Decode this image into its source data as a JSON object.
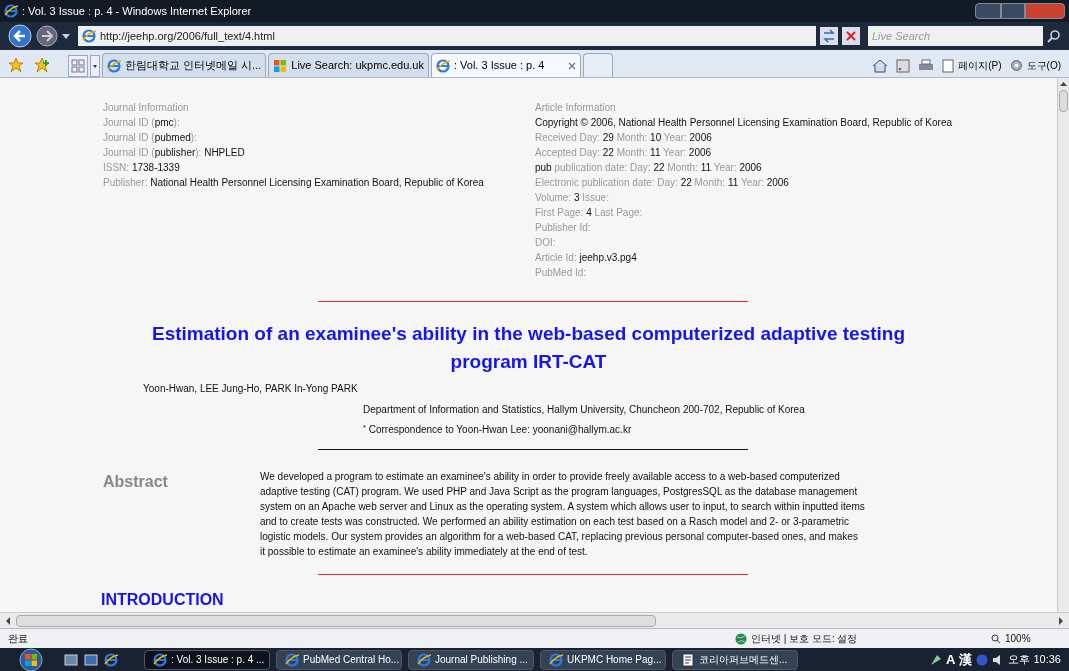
{
  "window": {
    "title": ": Vol. 3 Issue : p. 4 - Windows Internet Explorer"
  },
  "address_bar": {
    "url": "http://jeehp.org/2006/full_text/4.html"
  },
  "search": {
    "placeholder": "Live Search"
  },
  "tabs": [
    {
      "label": "한림대학교 인터넷메일 시...",
      "selected": false,
      "kind": "ie"
    },
    {
      "label": "Live Search: ukpmc.edu.uk",
      "selected": false,
      "kind": "windows"
    },
    {
      "label": ": Vol. 3 Issue : p. 4",
      "selected": true,
      "kind": "ie"
    }
  ],
  "command_bar": {
    "page_menu": "페이지(P)",
    "tools_menu": "도구(O)"
  },
  "page": {
    "journal_info": [
      "Journal Information",
      "Journal ID (**pmc**):",
      "Journal ID (**pubmed**):",
      "Journal ID (**publisher**): **NHPLED**",
      "ISSN: **1738-1339**",
      "Publisher: **National Health Personnel Licensing Examination Board, Republic of Korea**"
    ],
    "article_info": [
      "Article Information",
      "**Copyright © 2006, National Health Personnel Licensing Examination Board, Republic of Korea**",
      "Received Day: **29** Month: **10** Year: **2006**",
      "Accepted Day: **22** Month: **11** Year: **2006**",
      "**pub** publication date: Day: **22** Month: **11** Year: **2006**",
      "Electronic publication date: Day: **22** Month: **11** Year: **2006**",
      "Volume: **3** Issue:",
      "First Page: **4** Last Page:",
      "Publisher Id:",
      "DOI:",
      "Article Id: **jeehp.v3.pg4**",
      "PubMed Id:"
    ],
    "title": "Estimation of an examinee's ability in the web-based computerized adaptive testing program IRT-CAT",
    "authors": "Yoon-Hwan, LEE Jung-Ho, PARK In-Yong PARK",
    "affiliation": "Department of Information and Statistics, Hallym University, Chuncheon 200-702, Republic of Korea",
    "correspondence": "$^{*}$ Correspondence to Yoon-Hwan Lee: yoonani@hallym.ac.kr",
    "abstract_heading": "Abstract",
    "abstract": "We developed a program to estimate an examinee's ability in order to provide freely available access to a web-based computerized adaptive testing (CAT) program. We used PHP and Java Script as the program languages, PostgresSQL as the database management system on an Apache web server and Linux as the operating system. A system which allows user to input, to search within inputted items and to create tests was constructed. We performed an ability estimation on each test based on a Rasch model and 2- or 3-parametric logistic models. Our system provides an algorithm for a web-based CAT, replacing previous personal computer-based ones, and makes it possible to estimate an examinee's ability immediately at the end of test.",
    "section_heading": "INTRODUCTION"
  },
  "status_bar": {
    "status": "완료",
    "zone": "인터넷 | 보호 모드: 설정",
    "zoom": "100%"
  },
  "taskbar": {
    "tasks": [
      {
        "label": ": Vol. 3 Issue : p. 4 ...",
        "selected": true,
        "kind": "ie"
      },
      {
        "label": "PubMed Central Ho...",
        "selected": false,
        "kind": "ie"
      },
      {
        "label": "Journal Publishing ...",
        "selected": false,
        "kind": "ie"
      },
      {
        "label": "UKPMC Home Pag...",
        "selected": false,
        "kind": "ie"
      },
      {
        "label": "코리아퍼브메드센...",
        "selected": false,
        "kind": "doc"
      }
    ],
    "ime": [
      "A",
      "漢"
    ],
    "clock": "오후 10:36"
  }
}
